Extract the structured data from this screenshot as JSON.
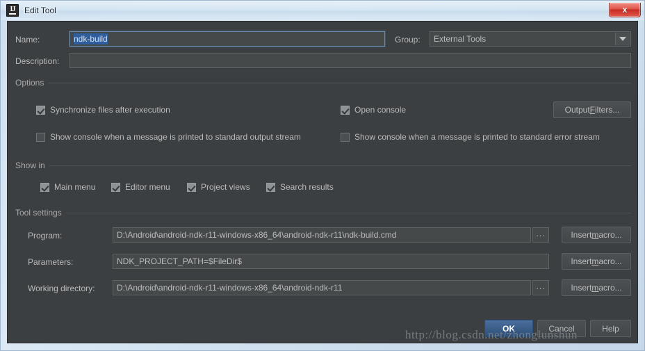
{
  "window": {
    "title": "Edit Tool",
    "icon": "intellij-idea-icon",
    "close_label": "x",
    "colors": {
      "dialog_bg": "#3c3f41",
      "field_bg": "#45494a",
      "text": "#bbbbbb",
      "selection": "#2f5e9e",
      "primary_button": "#2e4f77",
      "close_button": "#c62c22"
    }
  },
  "form": {
    "name_label": "Name:",
    "name_value": "ndk-build",
    "name_selected": true,
    "group_label": "Group:",
    "group_value": "External Tools",
    "description_label": "Description:",
    "description_value": "",
    "description_placeholder": ""
  },
  "options": {
    "section_label": "Options",
    "checkboxes": [
      {
        "label": "Synchronize files after execution",
        "checked": true
      },
      {
        "label": "Open console",
        "checked": true
      },
      {
        "label": "Show console when a message is printed to standard output stream",
        "checked": false
      },
      {
        "label": "Show console when a message is printed to standard error stream",
        "checked": false
      }
    ],
    "output_filters_pre": "Output ",
    "output_filters_mnemonic": "F",
    "output_filters_post": "ilters..."
  },
  "show_in": {
    "section_label": "Show in",
    "checkboxes": [
      {
        "label": "Main menu",
        "checked": true
      },
      {
        "label": "Editor menu",
        "checked": true
      },
      {
        "label": "Project views",
        "checked": true
      },
      {
        "label": "Search results",
        "checked": true
      }
    ]
  },
  "tool_settings": {
    "section_label": "Tool settings",
    "program_label": "Program:",
    "program_value": "D:\\Android\\android-ndk-r11-windows-x86_64\\android-ndk-r11\\ndk-build.cmd",
    "parameters_label": "Parameters:",
    "parameters_value": "NDK_PROJECT_PATH=$FileDir$",
    "working_directory_label": "Working directory:",
    "working_directory_value": "D:\\Android\\android-ndk-r11-windows-x86_64\\android-ndk-r11",
    "browse_label": "...",
    "insert_macro_pre": "Insert ",
    "insert_macro_mnemonic": "m",
    "insert_macro_post": "acro..."
  },
  "footer": {
    "ok_label": "OK",
    "cancel_label": "Cancel",
    "help_label": "Help"
  },
  "watermark": {
    "text": "http://blog.csdn.net/zhonglunshun"
  }
}
